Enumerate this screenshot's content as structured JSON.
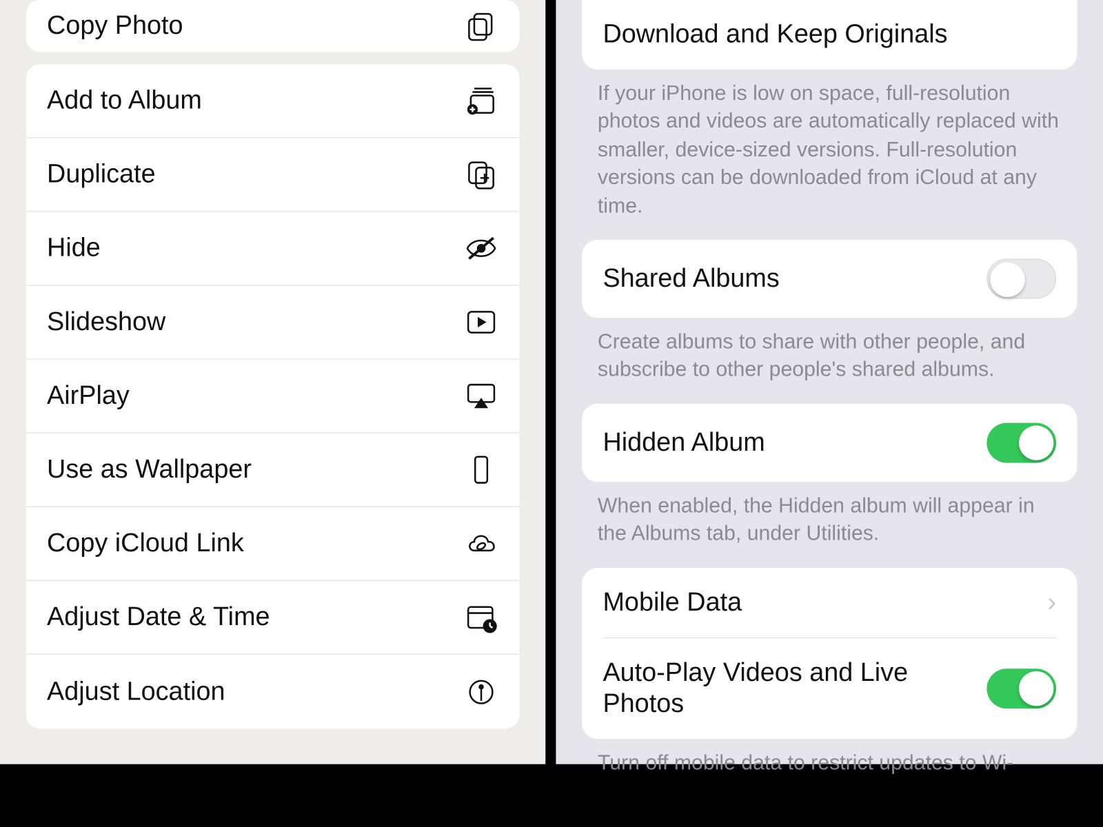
{
  "left": {
    "copy_photo": "Copy Photo",
    "items": [
      {
        "label": "Add to Album",
        "icon": "album-add-icon"
      },
      {
        "label": "Duplicate",
        "icon": "duplicate-icon"
      },
      {
        "label": "Hide",
        "icon": "eye-slash-icon"
      },
      {
        "label": "Slideshow",
        "icon": "play-rect-icon"
      },
      {
        "label": "AirPlay",
        "icon": "airplay-icon"
      },
      {
        "label": "Use as Wallpaper",
        "icon": "phone-rect-icon"
      },
      {
        "label": "Copy iCloud Link",
        "icon": "cloud-link-icon"
      },
      {
        "label": "Adjust Date & Time",
        "icon": "calendar-clock-icon"
      },
      {
        "label": "Adjust Location",
        "icon": "location-pin-icon"
      }
    ]
  },
  "right": {
    "download_originals": "Download and Keep Originals",
    "download_caption": "If your iPhone is low on space, full-resolution photos and videos are automatically replaced with smaller, device-sized versions. Full-resolution versions can be downloaded from iCloud at any time.",
    "shared_albums": {
      "label": "Shared Albums",
      "on": false
    },
    "shared_caption": "Create albums to share with other people, and subscribe to other people's shared albums.",
    "hidden_album": {
      "label": "Hidden Album",
      "on": true
    },
    "hidden_caption": "When enabled, the Hidden album will appear in the Albums tab, under Utilities.",
    "mobile_data": "Mobile Data",
    "autoplay": {
      "label": "Auto-Play Videos and Live Photos",
      "on": true
    },
    "autoplay_caption": "Turn off mobile data to restrict updates to Wi-"
  }
}
